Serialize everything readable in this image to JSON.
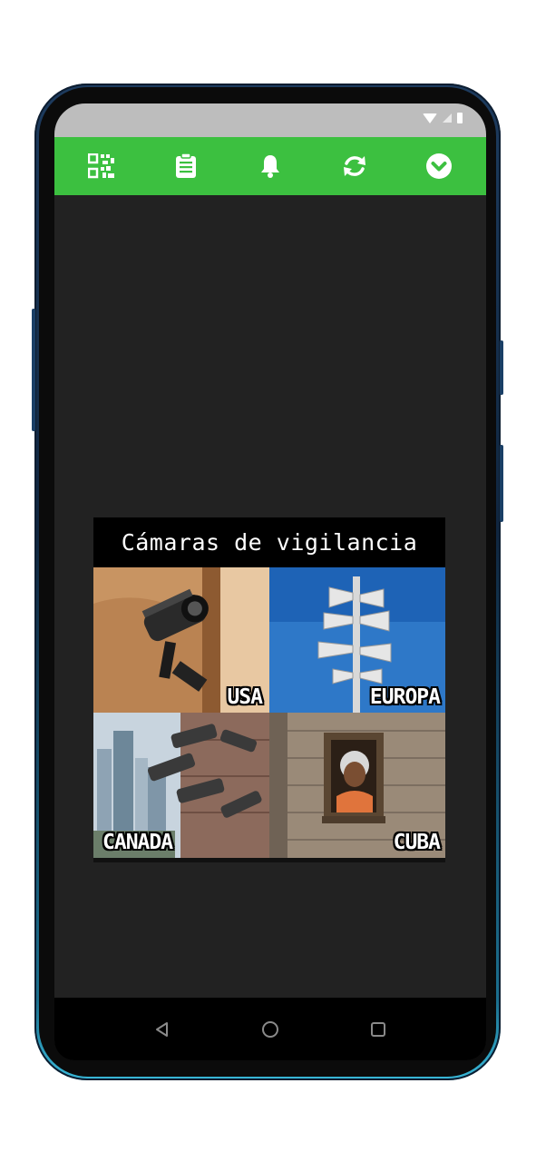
{
  "toolbar": {
    "accent_color": "#3cc040",
    "buttons": [
      {
        "icon": "qr-code-icon"
      },
      {
        "icon": "clipboard-list-icon"
      },
      {
        "icon": "bell-icon"
      },
      {
        "icon": "refresh-icon"
      },
      {
        "icon": "chevron-down-circle-icon"
      }
    ]
  },
  "meme": {
    "title": "Cámaras de vigilancia",
    "panels": [
      {
        "label": "USA"
      },
      {
        "label": "EUROPA"
      },
      {
        "label": "CANADA"
      },
      {
        "label": "CUBA"
      }
    ]
  },
  "navbar": {
    "buttons": [
      {
        "icon": "back-triangle-icon"
      },
      {
        "icon": "home-circle-icon"
      },
      {
        "icon": "recents-square-icon"
      }
    ]
  }
}
